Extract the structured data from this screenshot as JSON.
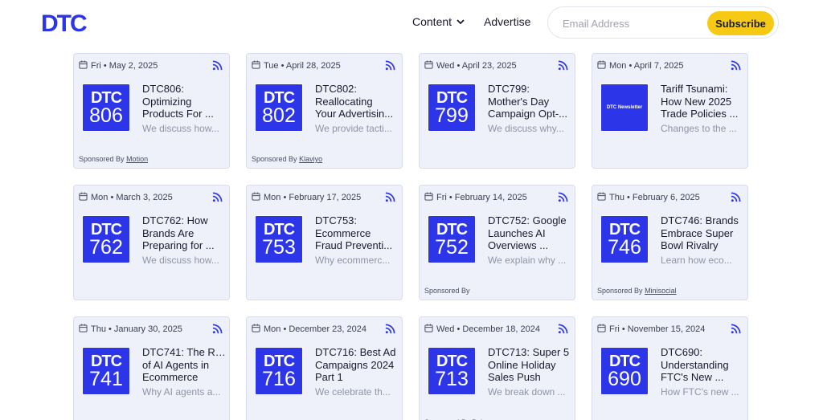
{
  "header": {
    "logo_text": "DTC",
    "nav": {
      "content_label": "Content",
      "advertise_label": "Advertise"
    },
    "subscribe": {
      "email_placeholder": "Email Address",
      "button_label": "Subscribe"
    }
  },
  "colors": {
    "brand_blue": "#2d35e8",
    "accent_yellow": "#f6c915",
    "card_bg": "#eef0fa"
  },
  "cards": [
    {
      "date": "Fri • May 2, 2025",
      "thumb_type": "episode",
      "thumb_dtc": "DTC",
      "thumb_num": "806",
      "title_lines": [
        "DTC806:",
        "Optimizing",
        "Products For ..."
      ],
      "desc": "We discuss how...",
      "sponsor_prefix": "Sponsored By",
      "sponsor_name": "Motion"
    },
    {
      "date": "Tue • April 28, 2025",
      "thumb_type": "episode",
      "thumb_dtc": "DTC",
      "thumb_num": "802",
      "title_lines": [
        "DTC802:",
        "Reallocating",
        "Your Advertisin..."
      ],
      "desc": "We provide tacti...",
      "sponsor_prefix": "Sponsored By",
      "sponsor_name": "Klaviyo"
    },
    {
      "date": "Wed • April 23, 2025",
      "thumb_type": "episode",
      "thumb_dtc": "DTC",
      "thumb_num": "799",
      "title_lines": [
        "DTC799:",
        "Mother's Day",
        "Campaign Opt-..."
      ],
      "desc": "We discuss why...",
      "sponsor_prefix": "",
      "sponsor_name": ""
    },
    {
      "date": "Mon • April 7, 2025",
      "thumb_type": "newsletter",
      "thumb_dtc": "DTC",
      "thumb_news": "Newsletter",
      "title_lines": [
        "Tariff Tsunami:",
        "How New 2025",
        "Trade Policies ..."
      ],
      "desc": "Changes to the ...",
      "sponsor_prefix": "",
      "sponsor_name": ""
    },
    {
      "date": "Mon • March 3, 2025",
      "thumb_type": "episode",
      "thumb_dtc": "DTC",
      "thumb_num": "762",
      "title_lines": [
        "DTC762: How",
        "Brands Are",
        "Preparing for ..."
      ],
      "desc": "We discuss how...",
      "sponsor_prefix": "",
      "sponsor_name": ""
    },
    {
      "date": "Mon • February 17, 2025",
      "thumb_type": "episode",
      "thumb_dtc": "DTC",
      "thumb_num": "753",
      "title_lines": [
        "DTC753:",
        "Ecommerce",
        "Fraud Preventi..."
      ],
      "desc": "Why ecommerc...",
      "sponsor_prefix": "",
      "sponsor_name": ""
    },
    {
      "date": "Fri • February 14, 2025",
      "thumb_type": "episode",
      "thumb_dtc": "DTC",
      "thumb_num": "752",
      "title_lines": [
        "DTC752: Google",
        "Launches AI",
        "Overviews ..."
      ],
      "desc": "We explain why ...",
      "sponsor_prefix": "Sponsored By",
      "sponsor_name": ""
    },
    {
      "date": "Thu • February 6, 2025",
      "thumb_type": "episode",
      "thumb_dtc": "DTC",
      "thumb_num": "746",
      "title_lines": [
        "DTC746: Brands",
        "Embrace Super",
        "Bowl Rivalry"
      ],
      "desc": "Learn how eco...",
      "sponsor_prefix": "Sponsored By",
      "sponsor_name": "Minisocial"
    },
    {
      "date": "Thu • January 30, 2025",
      "thumb_type": "episode",
      "thumb_dtc": "DTC",
      "thumb_num": "741",
      "title_lines": [
        "DTC741: The Rise",
        "of AI Agents in",
        "Ecommerce"
      ],
      "desc": "Why AI agents a...",
      "sponsor_prefix": "",
      "sponsor_name": ""
    },
    {
      "date": "Mon • December 23, 2024",
      "thumb_type": "episode",
      "thumb_dtc": "DTC",
      "thumb_num": "716",
      "title_lines": [
        "DTC716: Best Ad",
        "Campaigns 2024",
        "Part 1"
      ],
      "desc": "We celebrate th...",
      "sponsor_prefix": "",
      "sponsor_name": ""
    },
    {
      "date": "Wed • December 18, 2024",
      "thumb_type": "episode",
      "thumb_dtc": "DTC",
      "thumb_num": "713",
      "title_lines": [
        "DTC713: Super 5",
        "Online Holiday",
        "Sales Push"
      ],
      "desc": "We break down ...",
      "sponsor_prefix": "Sponsored By",
      "sponsor_name": "Baby"
    },
    {
      "date": "Fri • November 15, 2024",
      "thumb_type": "episode",
      "thumb_dtc": "DTC",
      "thumb_num": "690",
      "title_lines": [
        "DTC690:",
        "Understanding",
        "FTC's New ..."
      ],
      "desc": "How FTC's new ...",
      "sponsor_prefix": "",
      "sponsor_name": ""
    }
  ]
}
